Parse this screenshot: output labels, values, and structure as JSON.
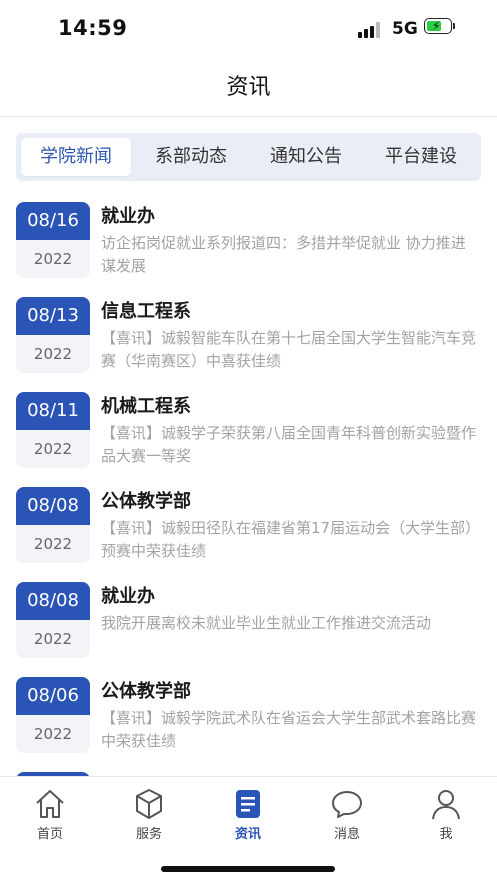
{
  "status_bar": {
    "time": "14:59",
    "network": "5G"
  },
  "header": {
    "title": "资讯"
  },
  "tabs": [
    {
      "label": "学院新闻",
      "active": true
    },
    {
      "label": "系部动态",
      "active": false
    },
    {
      "label": "通知公告",
      "active": false
    },
    {
      "label": "平台建设",
      "active": false
    }
  ],
  "news": [
    {
      "date": "08/16",
      "year": "2022",
      "dept": "就业办",
      "summary": "访企拓岗促就业系列报道四：多措并举促就业 协力推进谋发展"
    },
    {
      "date": "08/13",
      "year": "2022",
      "dept": "信息工程系",
      "summary": "【喜讯】诚毅智能车队在第十七届全国大学生智能汽车竞赛（华南赛区）中喜获佳绩"
    },
    {
      "date": "08/11",
      "year": "2022",
      "dept": "机械工程系",
      "summary": "【喜讯】诚毅学子荣获第八届全国青年科普创新实验暨作品大赛一等奖"
    },
    {
      "date": "08/08",
      "year": "2022",
      "dept": "公体教学部",
      "summary": "【喜讯】诚毅田径队在福建省第17届运动会（大学生部）预赛中荣获佳绩"
    },
    {
      "date": "08/08",
      "year": "2022",
      "dept": "就业办",
      "summary": "我院开展离校未就业毕业生就业工作推进交流活动"
    },
    {
      "date": "08/06",
      "year": "2022",
      "dept": "公体教学部",
      "summary": "【喜讯】诚毅学院武术队在省运会大学生部武术套路比赛中荣获佳绩"
    }
  ],
  "tab_bar": [
    {
      "label": "首页",
      "icon": "home-icon",
      "active": false
    },
    {
      "label": "服务",
      "icon": "cube-icon",
      "active": false
    },
    {
      "label": "资讯",
      "icon": "document-icon",
      "active": true
    },
    {
      "label": "消息",
      "icon": "chat-bubble-icon",
      "active": false
    },
    {
      "label": "我",
      "icon": "person-icon",
      "active": false
    }
  ],
  "colors": {
    "accent": "#2a55b7",
    "tab_bg": "#e9eef6",
    "battery": "#2ecc40"
  }
}
